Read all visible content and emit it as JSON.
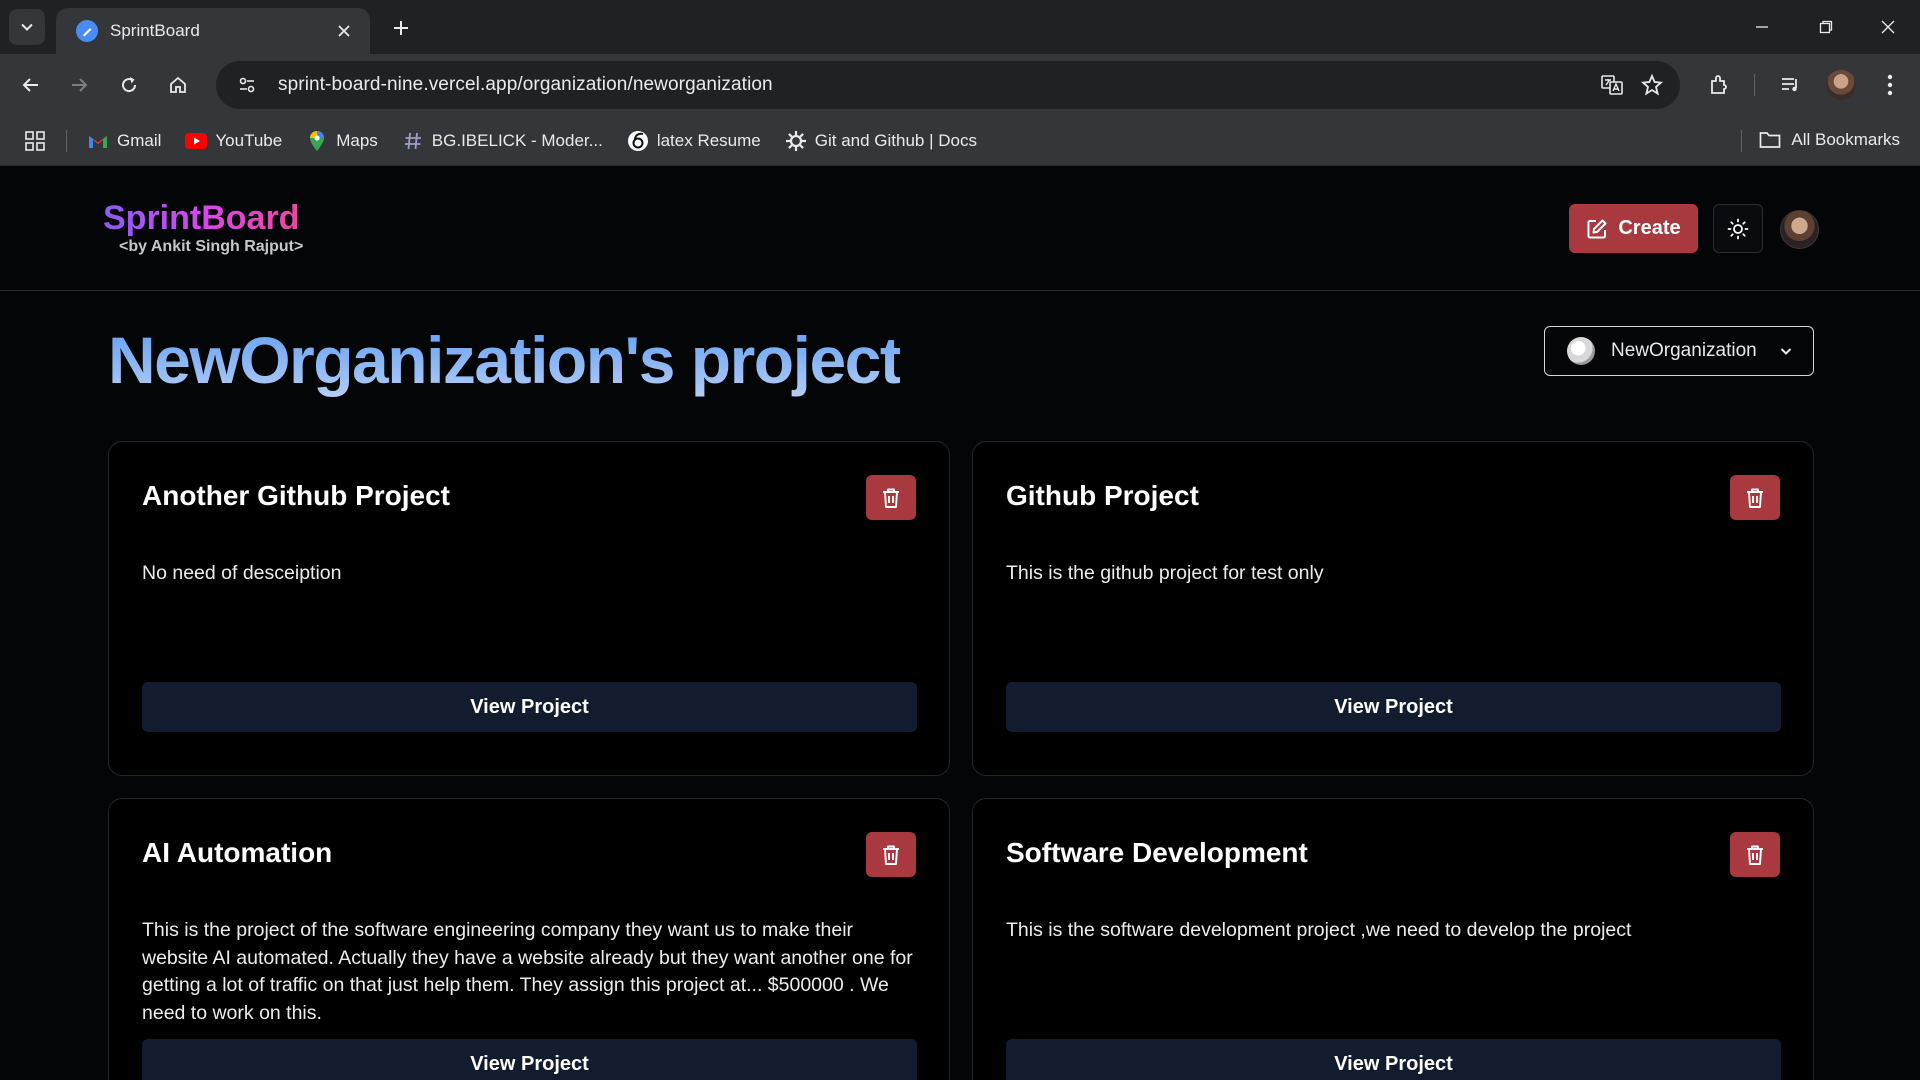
{
  "browser": {
    "tab": {
      "title": "SprintBoard"
    },
    "url": "sprint-board-nine.vercel.app/organization/neworganization",
    "bookmarks": [
      {
        "label": "Gmail",
        "icon": "gmail-icon"
      },
      {
        "label": "YouTube",
        "icon": "youtube-icon"
      },
      {
        "label": "Maps",
        "icon": "maps-icon"
      },
      {
        "label": "BG.IBELICK - Moder...",
        "icon": "hash-icon"
      },
      {
        "label": "latex Resume",
        "icon": "overleaf-icon"
      },
      {
        "label": "Git and Github | Docs",
        "icon": "gear-icon"
      }
    ],
    "all_bookmarks": "All Bookmarks"
  },
  "header": {
    "logo_title": "SprintBoard",
    "logo_subtitle": "<by Ankit Singh Rajput>",
    "create_label": "Create"
  },
  "page": {
    "title": "NewOrganization's project",
    "org_selector": "NewOrganization"
  },
  "projects": [
    {
      "title": "Another Github Project",
      "description": "No need of desceiption",
      "view_label": "View Project"
    },
    {
      "title": "Github Project",
      "description": "This is the github project for test only",
      "view_label": "View Project"
    },
    {
      "title": "AI Automation",
      "description": "This is the project of the software engineering company they want us to make their website AI automated. Actually they have a website already but they want another one for getting a lot of traffic on that just help them. They assign this project at... $500000 . We need to work on this.",
      "view_label": "View Project"
    },
    {
      "title": "Software Development",
      "description": "This is the software development project ,we need to develop the project",
      "view_label": "View Project"
    }
  ],
  "colors": {
    "accent_red": "#a83a3f",
    "view_button": "#131c2e",
    "title_gradient_start": "#5b9cf2",
    "logo_gradient_start": "#8b5cf6"
  }
}
